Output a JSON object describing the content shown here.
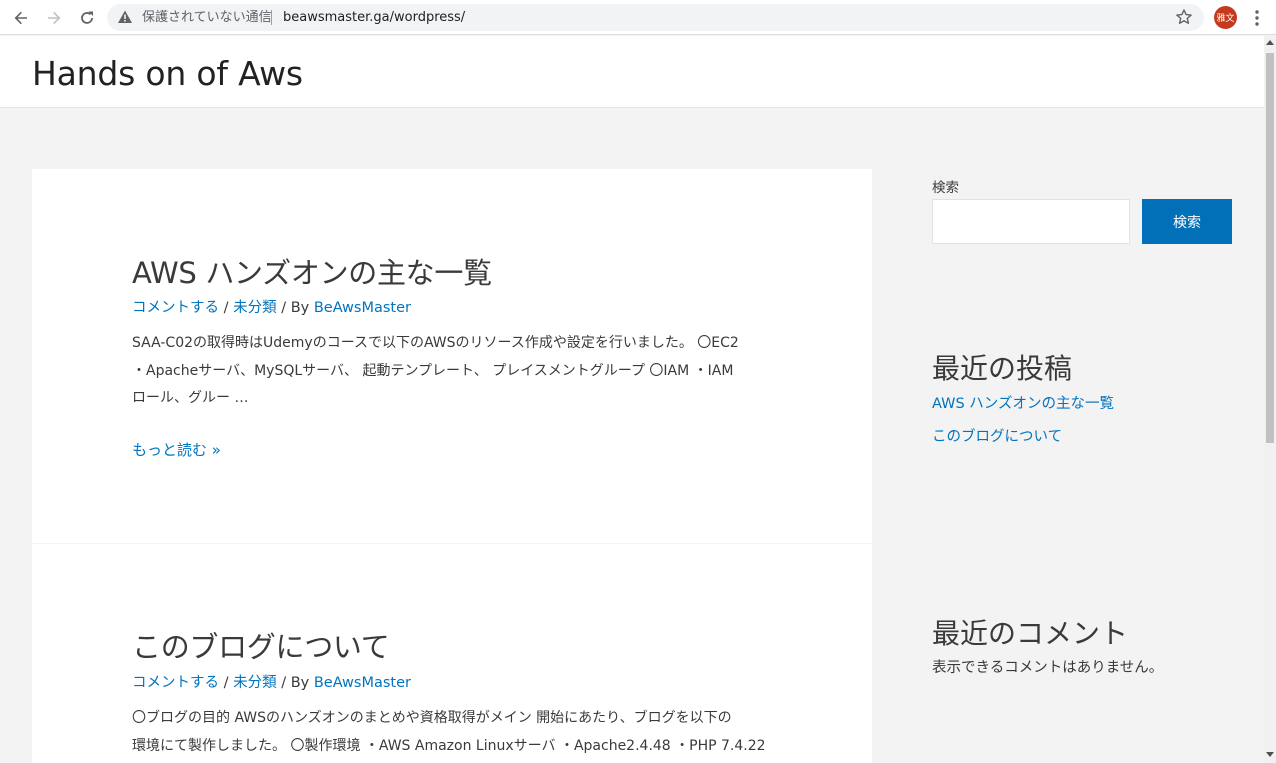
{
  "browser": {
    "security_text": "保護されていない通信",
    "url": "beawsmaster.ga/wordpress/",
    "profile_initials": "雅文",
    "icons": {
      "back": "back-arrow-icon",
      "forward": "forward-arrow-icon",
      "reload": "reload-icon",
      "warning": "warning-icon",
      "bookmark": "star-icon",
      "menu": "kebab-menu-icon"
    }
  },
  "site": {
    "title": "Hands on of Aws"
  },
  "posts": [
    {
      "title": "AWS ハンズオンの主な一覧",
      "meta": {
        "comment": "コメントする",
        "sep1": " / ",
        "category": "未分類",
        "sep2": " / By ",
        "author": "BeAwsMaster"
      },
      "excerpt_lines": [
        "SAA-C02の取得時はUdemyのコースで以下のAWSのリソース作成や設定を行いました。 〇EC2",
        "・Apacheサーバ、MySQLサーバ、 起動テンプレート、 プレイスメントグループ 〇IAM ・IAM",
        "ロール、グルー …"
      ],
      "read_more": "もっと読む »"
    },
    {
      "title": "このブログについて",
      "meta": {
        "comment": "コメントする",
        "sep1": " / ",
        "category": "未分類",
        "sep2": " / By ",
        "author": "BeAwsMaster"
      },
      "excerpt_lines": [
        "〇ブログの目的 AWSのハンズオンのまとめや資格取得がメイン 開始にあたり、ブログを以下の",
        "環境にて製作しました。 〇製作環境 ・AWS Amazon Linuxサーバ ・Apache2.4.48 ・PHP 7.4.22"
      ]
    }
  ],
  "sidebar": {
    "search_label": "検索",
    "search_value": "",
    "search_button": "検索",
    "recent_posts_heading": "最近の投稿",
    "recent_posts": [
      "AWS ハンズオンの主な一覧",
      "このブログについて"
    ],
    "recent_comments_heading": "最近のコメント",
    "no_comments": "表示できるコメントはありません。"
  },
  "colors": {
    "link": "#0274be",
    "button": "#0170b9",
    "page_bg": "#f3f3f3"
  }
}
